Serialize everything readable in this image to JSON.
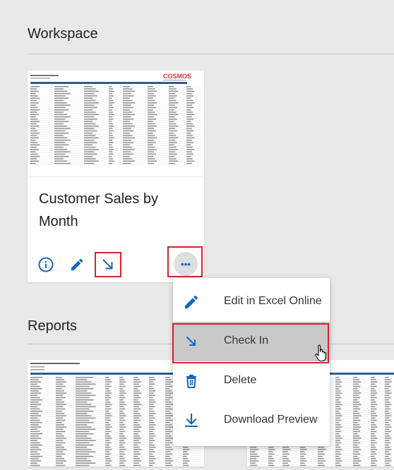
{
  "workspace": {
    "section_title": "Workspace",
    "card": {
      "title": "Customer Sales by Month",
      "thumbnail_logo": "COSMOS",
      "actions": [
        {
          "name": "info-icon"
        },
        {
          "name": "edit-icon"
        },
        {
          "name": "check-in-arrow-icon"
        },
        {
          "name": "more-options-icon",
          "label": "•••"
        }
      ]
    }
  },
  "reports": {
    "section_title": "Reports"
  },
  "context_menu": {
    "items": [
      {
        "label": "Edit in Excel Online",
        "icon": "pencil-icon"
      },
      {
        "label": "Check In",
        "icon": "check-in-arrow-icon",
        "active": true
      },
      {
        "label": "Delete",
        "icon": "trash-icon"
      },
      {
        "label": "Download Preview",
        "icon": "download-icon"
      }
    ]
  },
  "colors": {
    "accent": "#1565c0",
    "highlight": "#d0262c",
    "background": "#e9e9e9"
  }
}
